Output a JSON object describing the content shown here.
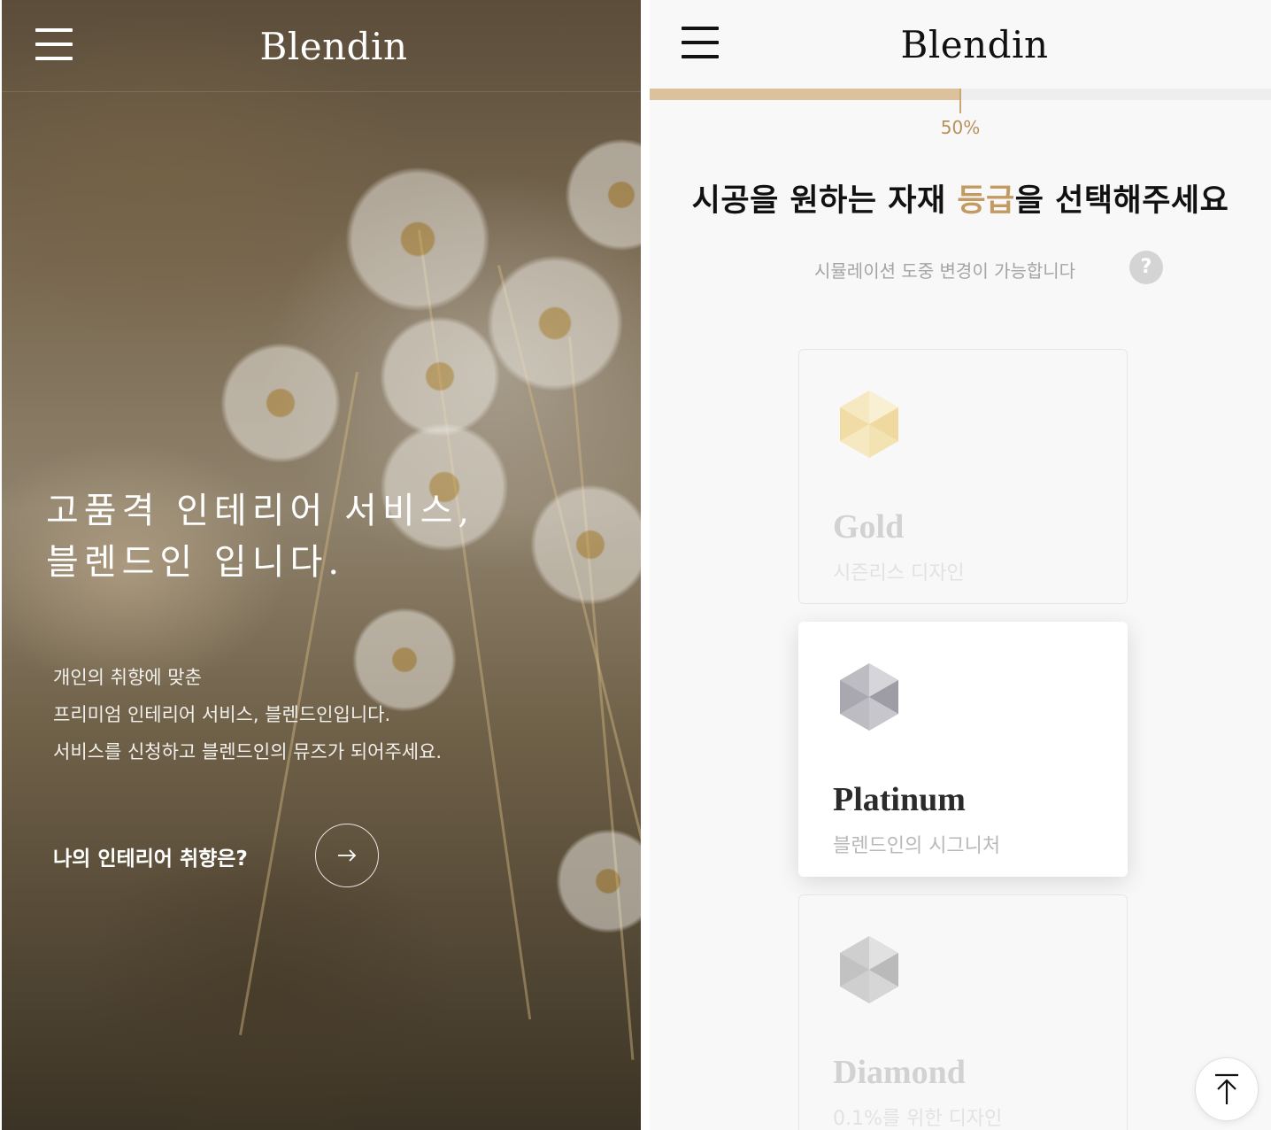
{
  "left_screen": {
    "logo": "Blendin",
    "hero": {
      "title_line1": "고품격 인테리어 서비스,",
      "title_line2": "블렌드인 입니다."
    },
    "description": {
      "line1": "개인의 취향에 맞춘",
      "line2": "프리미엄 인테리어 서비스, 블렌드인입니다.",
      "line3": "서비스를 신청하고 블렌드인의 뮤즈가 되어주세요."
    },
    "cta": {
      "label": "나의 인테리어 취향은?",
      "icon": "arrow-right-icon"
    },
    "icons": {
      "menu": "hamburger-menu-icon"
    }
  },
  "right_screen": {
    "logo": "Blendin",
    "progress": {
      "value": 0.5,
      "label": "50%",
      "fill_color": "#dcc19d"
    },
    "question": {
      "before": "시공을 원하는 자재 ",
      "accent": "등급",
      "after": "을 선택해주세요",
      "accent_color": "#c39a62"
    },
    "subtext": "시뮬레이션 도중 변경이 가능합니다",
    "help_icon_text": "?",
    "grades": [
      {
        "name": "Gold",
        "subtitle": "시즌리스 디자인",
        "icon": "gold-cube-icon",
        "selected": false
      },
      {
        "name": "Platinum",
        "subtitle": "블렌드인의 시그니처",
        "icon": "platinum-cube-icon",
        "selected": true
      },
      {
        "name": "Diamond",
        "subtitle": "0.1%를 위한 디자인",
        "icon": "diamond-cube-icon",
        "selected": false
      }
    ],
    "icons": {
      "menu": "hamburger-menu-icon",
      "scroll_top": "scroll-to-top-icon"
    }
  }
}
